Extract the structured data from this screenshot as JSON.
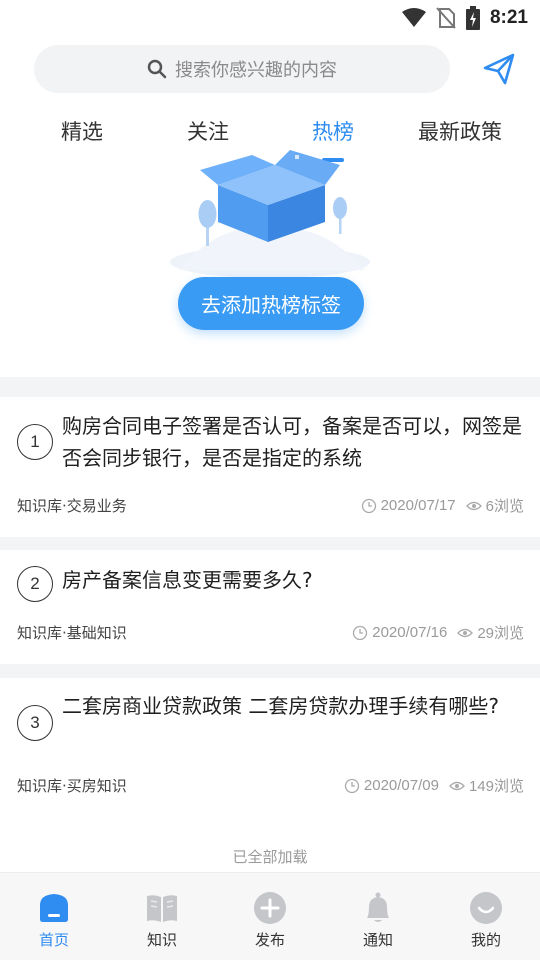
{
  "status_bar": {
    "time": "8:21"
  },
  "search": {
    "placeholder": "搜索你感兴趣的内容"
  },
  "tabs": [
    {
      "label": "精选",
      "active": false
    },
    {
      "label": "关注",
      "active": false
    },
    {
      "label": "热榜",
      "active": true
    },
    {
      "label": "最新政策",
      "active": false
    }
  ],
  "empty_state": {
    "button_label": "去添加热榜标签"
  },
  "articles": [
    {
      "rank": "1",
      "title": "购房合同电子签署是否认可，备案是否可以，网签是否会同步银行，是否是指定的系统",
      "category": "知识库·交易业务",
      "date": "2020/07/17",
      "views": "6浏览"
    },
    {
      "rank": "2",
      "title": "房产备案信息变更需要多久?",
      "category": "知识库·基础知识",
      "date": "2020/07/16",
      "views": "29浏览"
    },
    {
      "rank": "3",
      "title": "二套房商业贷款政策 二套房贷款办理手续有哪些?",
      "category": "知识库·买房知识",
      "date": "2020/07/09",
      "views": "149浏览"
    }
  ],
  "footer": {
    "all_loaded": "已全部加载"
  },
  "bottom_nav": [
    {
      "label": "首页",
      "icon": "home-icon",
      "active": true
    },
    {
      "label": "知识",
      "icon": "book-icon",
      "active": false
    },
    {
      "label": "发布",
      "icon": "plus-circle-icon",
      "active": false
    },
    {
      "label": "通知",
      "icon": "bell-icon",
      "active": false
    },
    {
      "label": "我的",
      "icon": "smile-icon",
      "active": false
    }
  ],
  "colors": {
    "accent": "#2f8cf1",
    "button": "#3a9bf4",
    "band": "#f3f4f6",
    "muted": "#9a9a9a"
  }
}
